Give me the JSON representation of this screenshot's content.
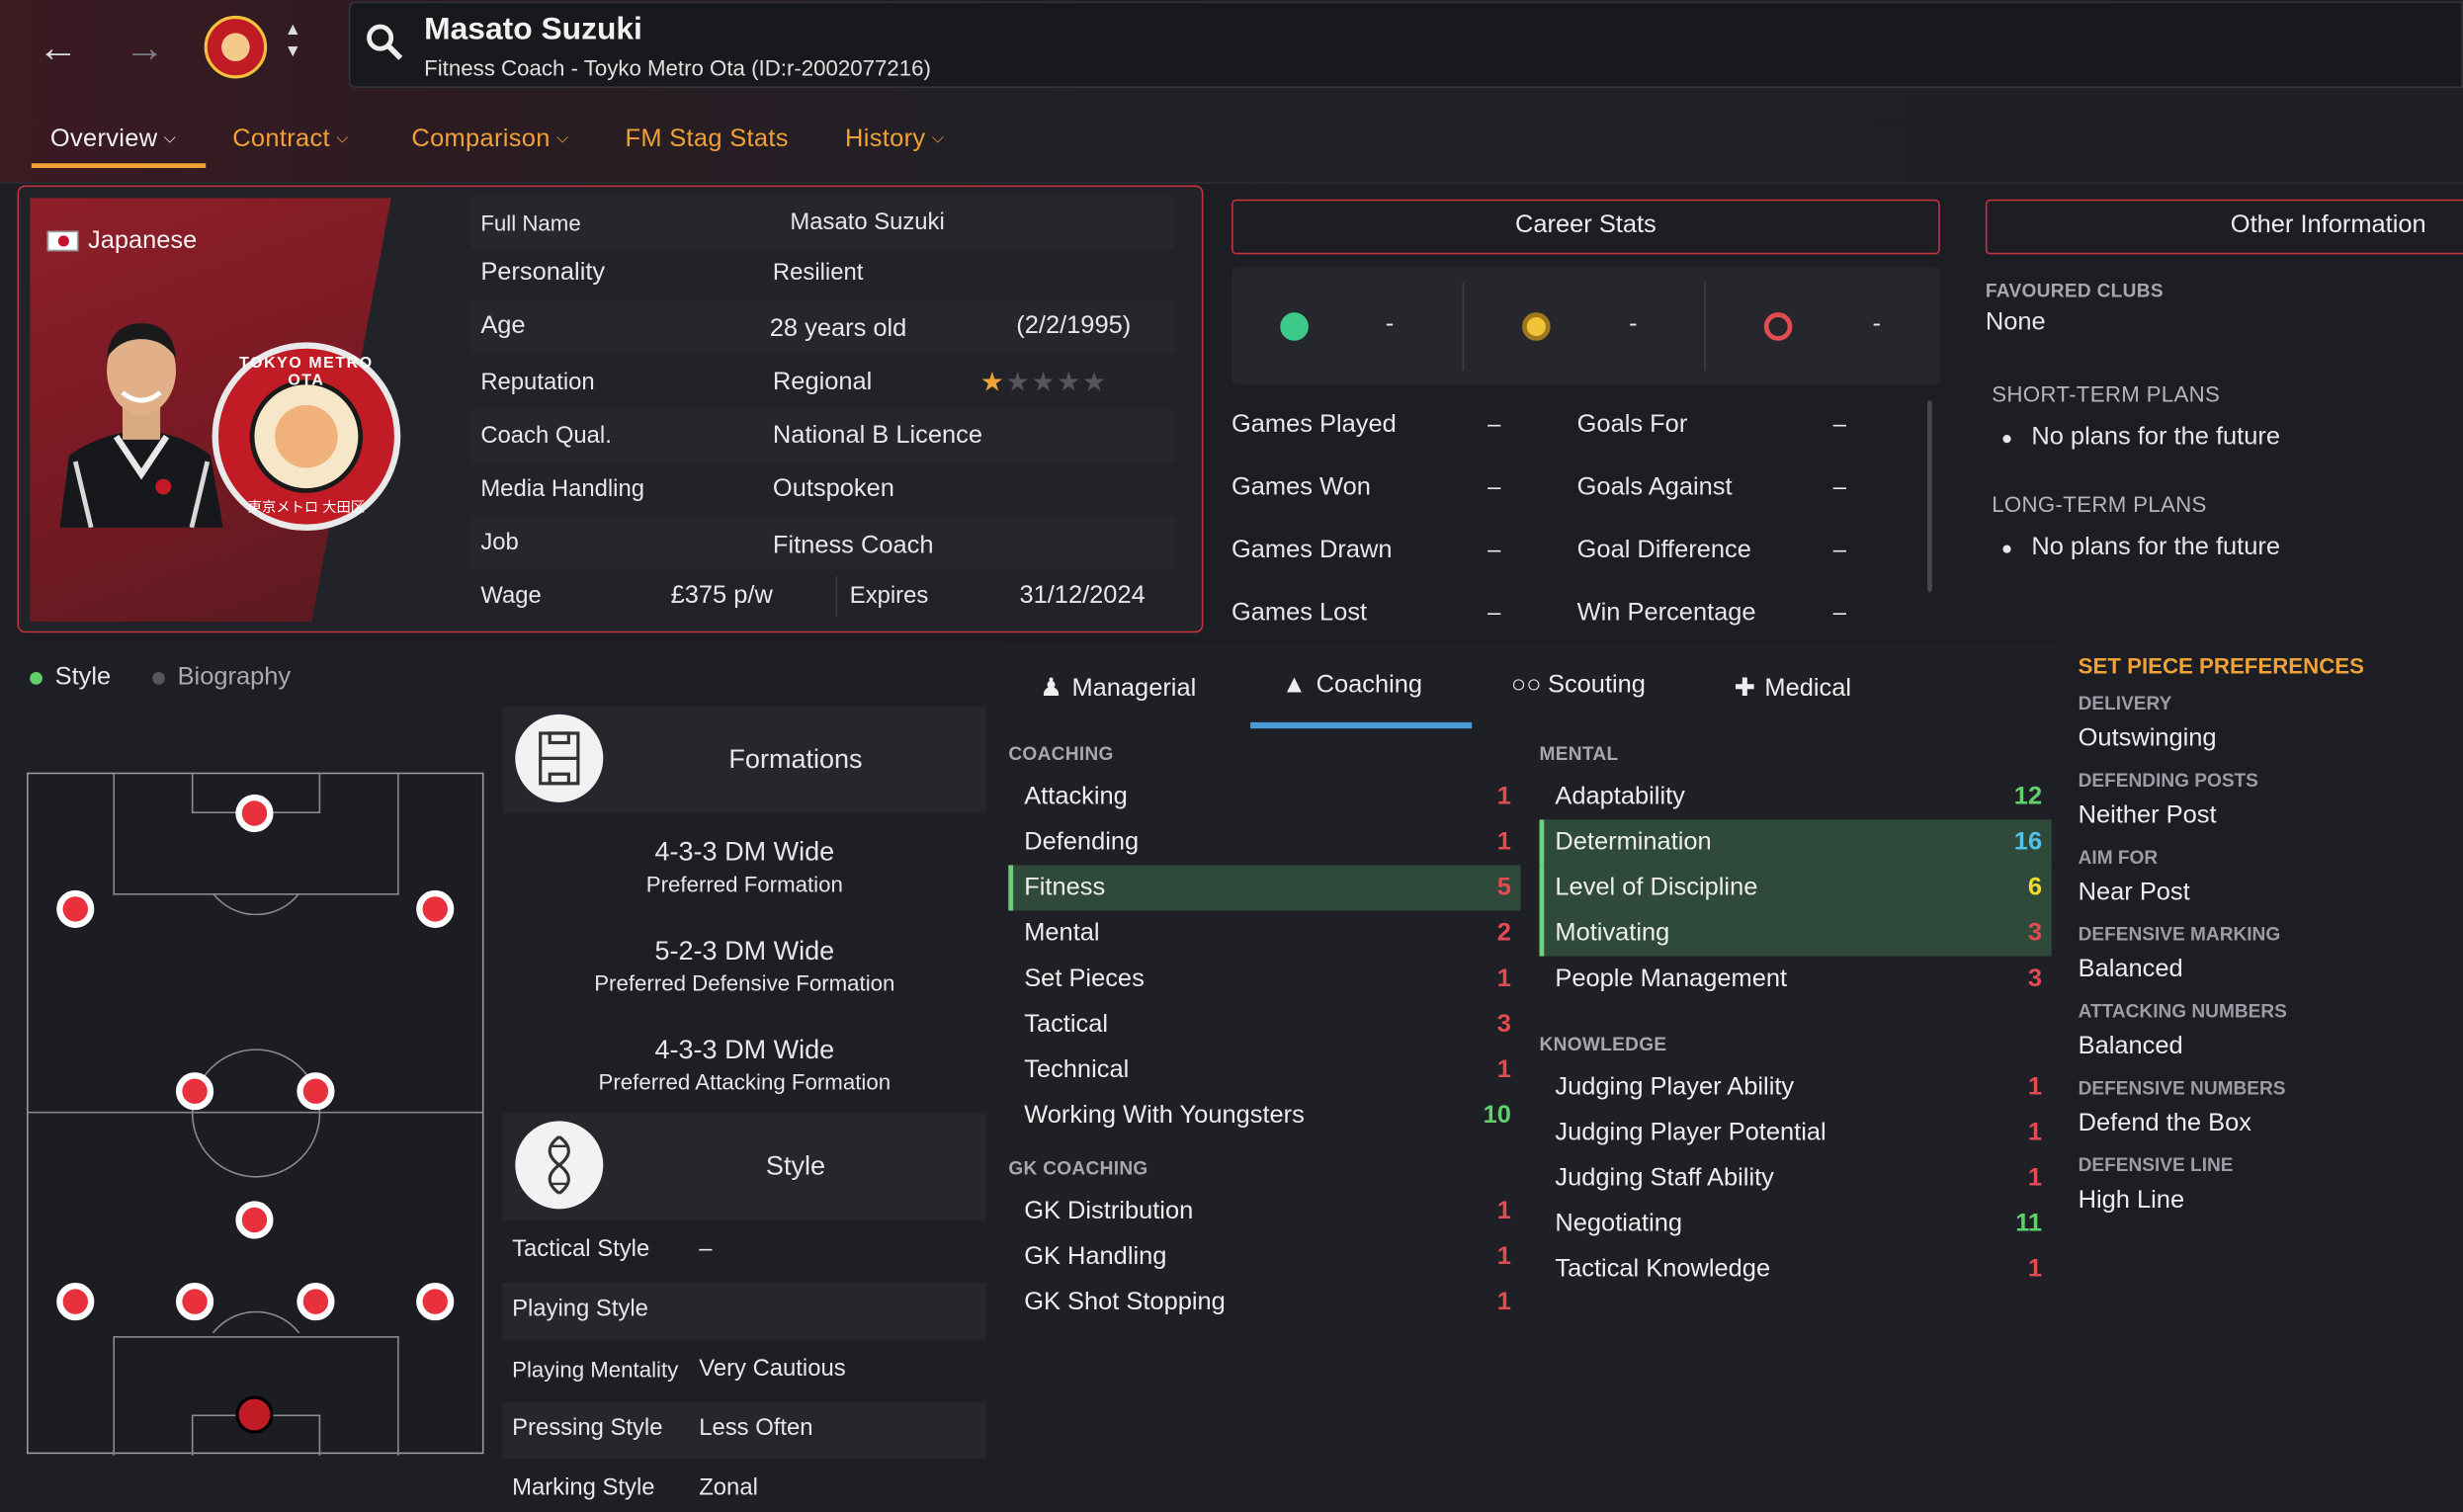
{
  "header": {
    "name": "Masato Suzuki",
    "subtitle": "Fitness Coach - Toyko Metro Ota (ID:r-2002077216)"
  },
  "tabs": [
    {
      "label": "Overview"
    },
    {
      "label": "Contract"
    },
    {
      "label": "Comparison"
    },
    {
      "label": "FM Stag Stats"
    },
    {
      "label": "History"
    }
  ],
  "profile": {
    "nationality": "Japanese",
    "rows": [
      {
        "label": "Full Name",
        "value": "Masato Suzuki"
      },
      {
        "label": "Personality",
        "value": "Resilient"
      },
      {
        "label": "Age",
        "value": "28 years old",
        "extra": "(2/2/1995)"
      },
      {
        "label": "Reputation",
        "value": "Regional",
        "stars": "0.5/5"
      },
      {
        "label": "Coach Qual.",
        "value": "National B Licence"
      },
      {
        "label": "Media Handling",
        "value": "Outspoken"
      },
      {
        "label": "Job",
        "value": "Fitness Coach"
      }
    ],
    "wage_label": "Wage",
    "wage": "£375 p/w",
    "expires_label": "Expires",
    "expires": "31/12/2024",
    "badge_text": "TOKYO METRO OTA",
    "badge_sub": "東京メトロ 大田区"
  },
  "career": {
    "title": "Career Stats",
    "summary": [
      "-",
      "-",
      "-"
    ],
    "left": [
      {
        "label": "Games Played",
        "value": "–"
      },
      {
        "label": "Games Won",
        "value": "–"
      },
      {
        "label": "Games Drawn",
        "value": "–"
      },
      {
        "label": "Games Lost",
        "value": "–"
      }
    ],
    "right": [
      {
        "label": "Goals For",
        "value": "–"
      },
      {
        "label": "Goals Against",
        "value": "–"
      },
      {
        "label": "Goal Difference",
        "value": "–"
      },
      {
        "label": "Win Percentage",
        "value": "–"
      }
    ]
  },
  "other": {
    "title": "Other Information",
    "fav_h": "FAVOURED CLUBS",
    "fav": "None",
    "short_h": "SHORT-TERM PLANS",
    "short": "No plans for the future",
    "long_h": "LONG-TERM PLANS",
    "long": "No plans for the future"
  },
  "style_tabs": {
    "style": "Style",
    "bio": "Biography"
  },
  "formations": {
    "title": "Formations",
    "items": [
      {
        "name": "4-3-3 DM Wide",
        "desc": "Preferred Formation"
      },
      {
        "name": "5-2-3 DM Wide",
        "desc": "Preferred Defensive Formation"
      },
      {
        "name": "4-3-3 DM Wide",
        "desc": "Preferred Attacking Formation"
      }
    ]
  },
  "style": {
    "title": "Style",
    "rows": [
      {
        "label": "Tactical Style",
        "value": "–"
      },
      {
        "label": "Playing Style",
        "value": ""
      },
      {
        "label": "Playing Mentality",
        "value": "Very Cautious"
      },
      {
        "label": "Pressing Style",
        "value": "Less Often"
      },
      {
        "label": "Marking Style",
        "value": "Zonal"
      }
    ]
  },
  "attr_tabs": [
    "Managerial",
    "Coaching",
    "Scouting",
    "Medical"
  ],
  "coaching": {
    "h": "COACHING",
    "items": [
      {
        "n": "Attacking",
        "v": "1"
      },
      {
        "n": "Defending",
        "v": "1"
      },
      {
        "n": "Fitness",
        "v": "5"
      },
      {
        "n": "Mental",
        "v": "2"
      },
      {
        "n": "Set Pieces",
        "v": "1"
      },
      {
        "n": "Tactical",
        "v": "3"
      },
      {
        "n": "Technical",
        "v": "1"
      },
      {
        "n": "Working With Youngsters",
        "v": "10"
      }
    ]
  },
  "gk": {
    "h": "GK COACHING",
    "items": [
      {
        "n": "GK Distribution",
        "v": "1"
      },
      {
        "n": "GK Handling",
        "v": "1"
      },
      {
        "n": "GK Shot Stopping",
        "v": "1"
      }
    ]
  },
  "mental": {
    "h": "MENTAL",
    "items": [
      {
        "n": "Adaptability",
        "v": "12"
      },
      {
        "n": "Determination",
        "v": "16"
      },
      {
        "n": "Level of Discipline",
        "v": "6"
      },
      {
        "n": "Motivating",
        "v": "3"
      },
      {
        "n": "People Management",
        "v": "3"
      }
    ]
  },
  "knowledge": {
    "h": "KNOWLEDGE",
    "items": [
      {
        "n": "Judging Player Ability",
        "v": "1"
      },
      {
        "n": "Judging Player Potential",
        "v": "1"
      },
      {
        "n": "Judging Staff Ability",
        "v": "1"
      },
      {
        "n": "Negotiating",
        "v": "11"
      },
      {
        "n": "Tactical Knowledge",
        "v": "1"
      }
    ]
  },
  "setpiece": {
    "title": "SET PIECE PREFERENCES",
    "items": [
      {
        "h": "DELIVERY",
        "v": "Outswinging"
      },
      {
        "h": "DEFENDING POSTS",
        "v": "Neither Post"
      },
      {
        "h": "AIM FOR",
        "v": "Near Post"
      },
      {
        "h": "DEFENSIVE MARKING",
        "v": "Balanced"
      },
      {
        "h": "ATTACKING NUMBERS",
        "v": "Balanced"
      },
      {
        "h": "DEFENSIVE NUMBERS",
        "v": "Defend the Box"
      },
      {
        "h": "DEFENSIVE LINE",
        "v": "High Line"
      }
    ]
  },
  "colors": {
    "accent": "#f0a236",
    "red": "#c4323d",
    "good": "#5fd06a",
    "mid": "#f0dc2a",
    "low": "#e24b52",
    "high": "#4fc3e8"
  }
}
